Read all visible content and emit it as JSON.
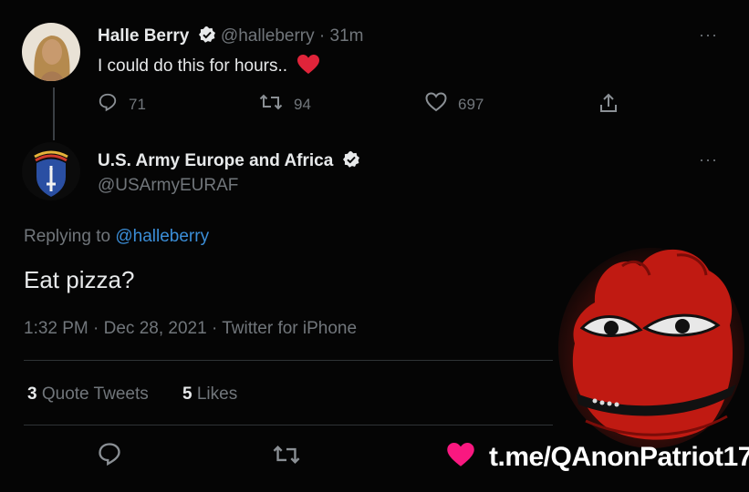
{
  "tweet1": {
    "author_name": "Halle Berry",
    "handle": "@halleberry",
    "time": "· 31m",
    "text": "I could do this for hours..",
    "replies": "71",
    "retweets": "94",
    "likes": "697",
    "more": "···"
  },
  "tweet2": {
    "author_name": "U.S. Army Europe and Africa",
    "handle": "@USArmyEURAF",
    "more": "···",
    "replying_prefix": "Replying to",
    "replying_handle": "@halleberry",
    "text": "Eat pizza?",
    "timestamp": "1:32 PM · Dec 28, 2021 · Twitter for iPhone",
    "quote_count": "3",
    "quote_label": "Quote Tweets",
    "like_count": "5",
    "like_label": "Likes"
  },
  "watermark": "t.me/QAnonPatriot17",
  "colors": {
    "background": "#050505",
    "muted": "#71767b",
    "link": "#3b8ed8",
    "heart": "#f91880"
  }
}
